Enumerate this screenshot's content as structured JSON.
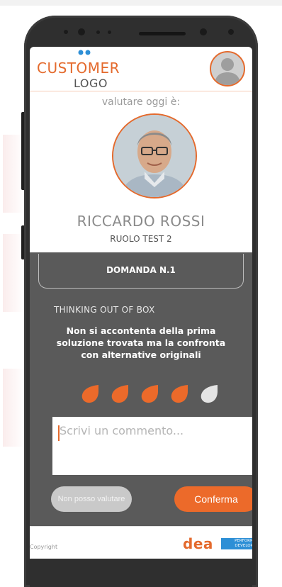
{
  "header": {
    "logo_line1": "CUSTOMER",
    "logo_line2": "LOGO"
  },
  "evaluation": {
    "subtitle": "valutare oggi è:",
    "name": "RICCARDO ROSSI",
    "role": "RUOLO TEST 2"
  },
  "question": {
    "title": "DOMANDA N.1",
    "category": "THINKING OUT OF BOX",
    "text": "Non si accontenta della prima soluzione trovata ma la confronta con alternative originali",
    "rating": 4,
    "max_rating": 5
  },
  "comment": {
    "placeholder": "Scrivi un commento..."
  },
  "buttons": {
    "cancel": "Non posso valutare",
    "confirm": "Conferma"
  },
  "footer": {
    "copyright": "Copyright",
    "logo_text": "dea",
    "logo_badge": "PERFORMANCE DEVELOPMENT"
  },
  "colors": {
    "accent": "#ec6a2a",
    "brand_blue": "#2d8fd6",
    "panel": "#5a5a5a"
  }
}
